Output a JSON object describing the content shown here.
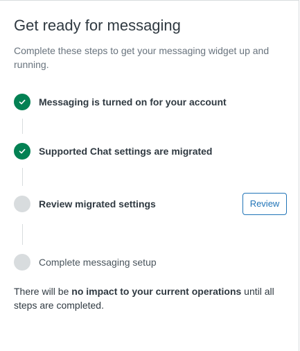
{
  "header": {
    "title": "Get ready for messaging",
    "subtitle": "Complete these steps to get your messaging widget up and running."
  },
  "steps": [
    {
      "label": "Messaging is turned on for your account",
      "status": "complete",
      "icon": "check-icon"
    },
    {
      "label": "Supported Chat settings are migrated",
      "status": "complete",
      "icon": "check-icon"
    },
    {
      "label": "Review migrated settings",
      "status": "pending",
      "action_label": "Review"
    },
    {
      "label": "Complete messaging setup",
      "status": "pending"
    }
  ],
  "footer": {
    "prefix": "There will be ",
    "emphasis": "no impact to your current operations",
    "suffix": " until all steps are completed."
  },
  "colors": {
    "complete": "#038153",
    "pending": "#d8dcde",
    "accent": "#1f73b7",
    "muted_text": "#68737d"
  }
}
